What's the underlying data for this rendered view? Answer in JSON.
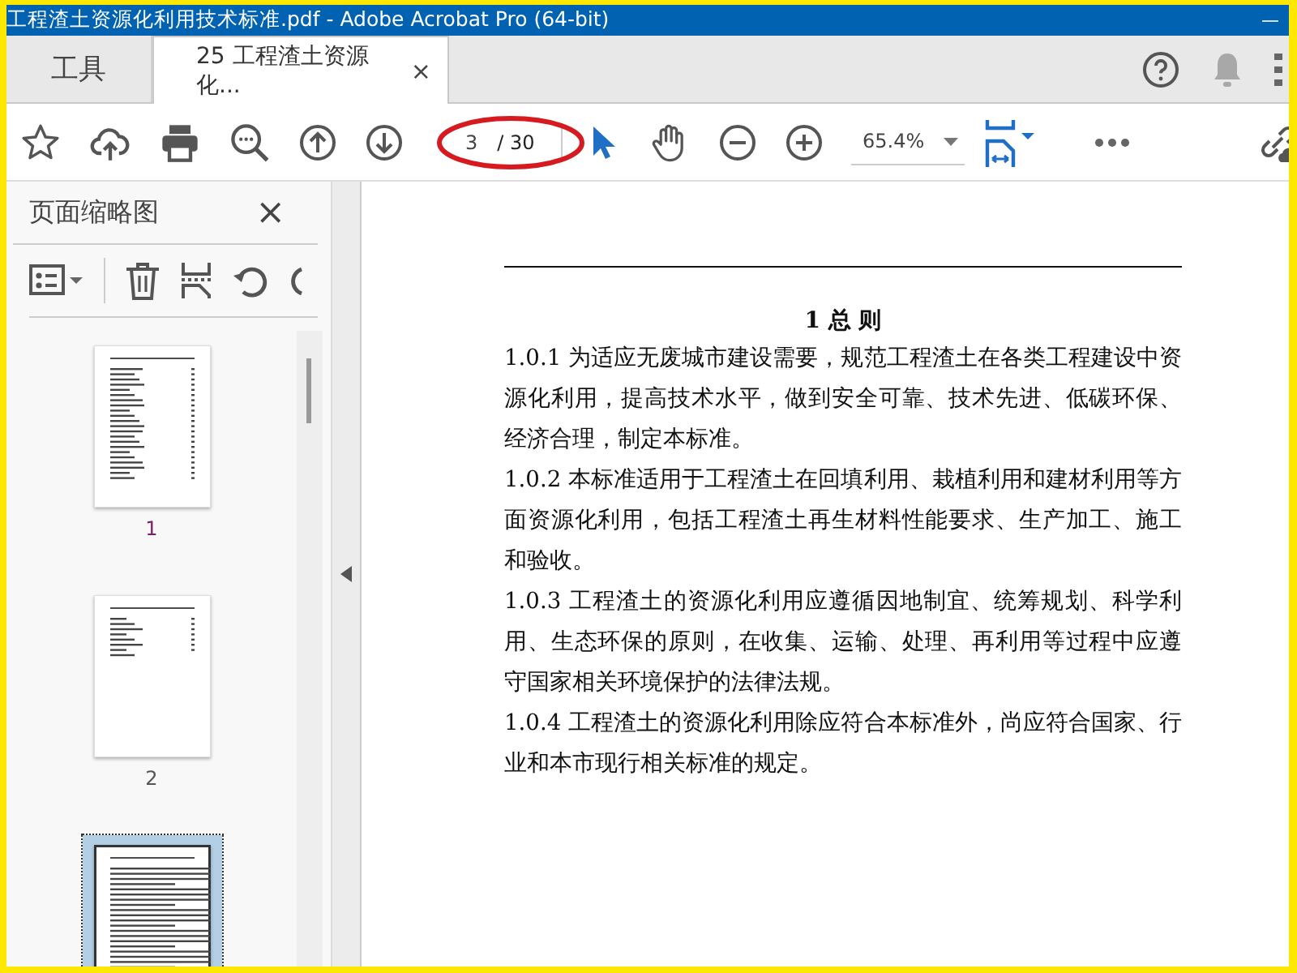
{
  "window": {
    "title": "工程渣土资源化利用技术标准.pdf - Adobe Acrobat Pro (64-bit)",
    "minimize": "—"
  },
  "tabs": [
    {
      "label": "工具",
      "selected": false
    },
    {
      "label": "25 工程渣土资源化...",
      "selected": true,
      "close": "×"
    }
  ],
  "toolbar": {
    "page_field": {
      "value": "3",
      "total": "/ 30"
    },
    "zoom": {
      "value": "65.4%"
    }
  },
  "thumbnails_panel": {
    "title": "页面缩略图",
    "close": "×",
    "pages": [
      {
        "label": "1",
        "selected": false,
        "kind": "contents"
      },
      {
        "label": "2",
        "selected": false,
        "kind": "contents-end"
      },
      {
        "selected": true,
        "kind": "text"
      }
    ]
  },
  "document": {
    "heading": "1 总 则",
    "paragraphs": [
      "1.0.1  为适应无废城市建设需要，规范工程渣土在各类工程建设中资源化利用，提高技术水平，做到安全可靠、技术先进、低碳环保、经济合理，制定本标准。",
      "1.0.2  本标准适用于工程渣土在回填利用、栽植利用和建材利用等方面资源化利用，包括工程渣土再生材料性能要求、生产加工、施工和验收。",
      "1.0.3 工程渣土的资源化利用应遵循因地制宜、统筹规划、科学利用、生态环保的原则，在收集、运输、处理、再利用等过程中应遵守国家相关环境保护的法律法规。",
      "1.0.4  工程渣土的资源化利用除应符合本标准外，尚应符合国家、行业和本市现行相关标准的规定。"
    ]
  }
}
